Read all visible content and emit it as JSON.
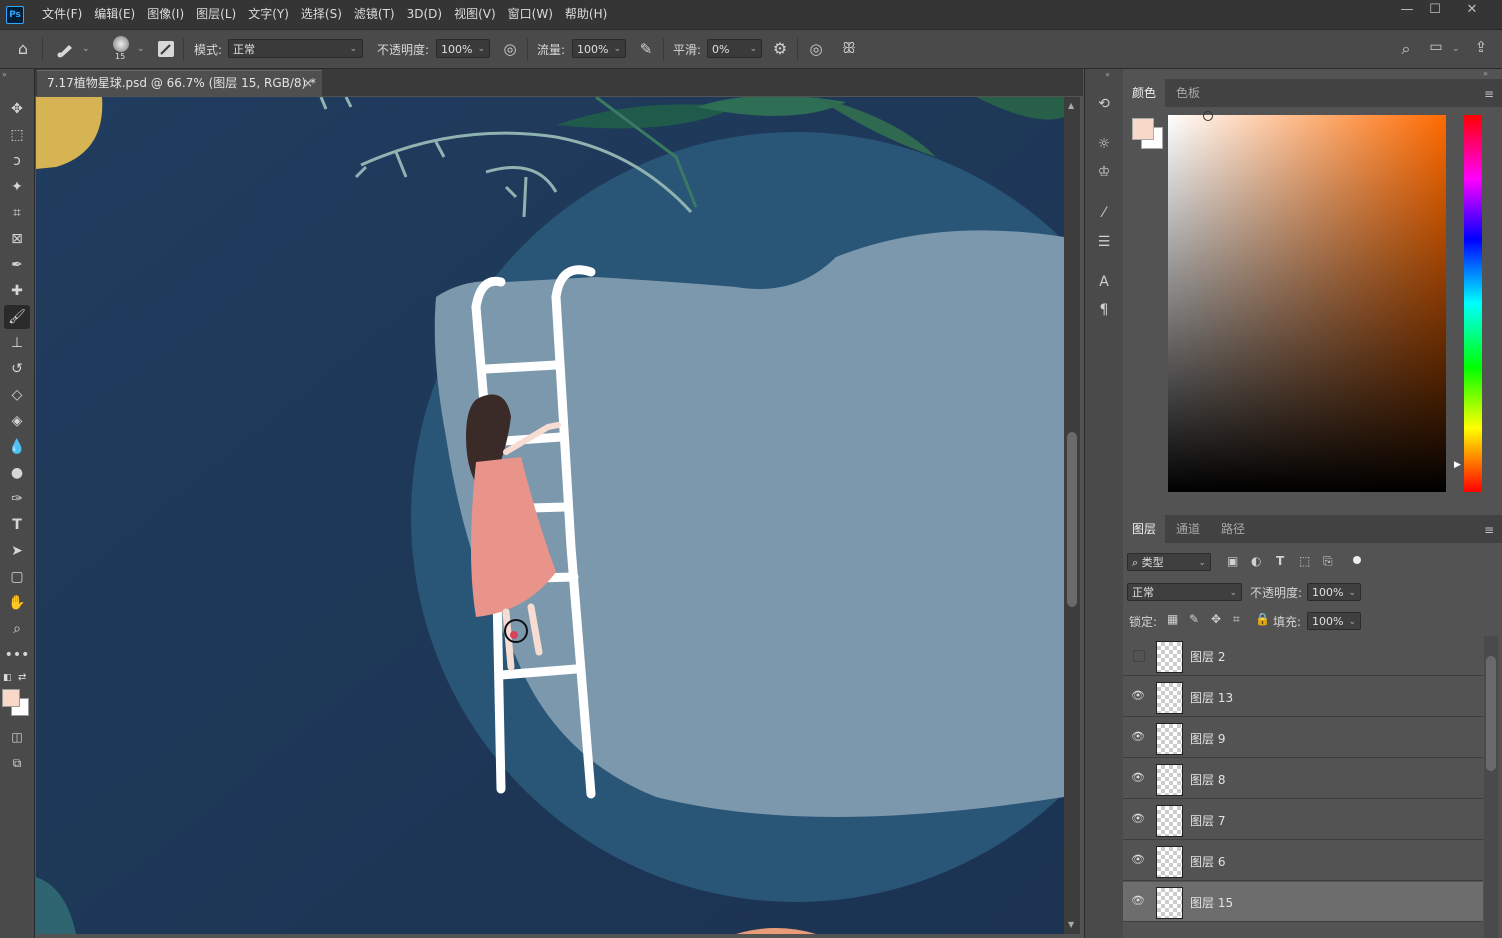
{
  "app": {
    "logo": "Ps"
  },
  "menu": [
    "文件(F)",
    "编辑(E)",
    "图像(I)",
    "图层(L)",
    "文字(Y)",
    "选择(S)",
    "滤镜(T)",
    "3D(D)",
    "视图(V)",
    "窗口(W)",
    "帮助(H)"
  ],
  "window_controls": {
    "minimize": "—",
    "maximize": "☐",
    "close": "✕"
  },
  "options": {
    "brush_size": "15",
    "mode_label": "模式:",
    "mode_value": "正常",
    "opacity_label": "不透明度:",
    "opacity_value": "100%",
    "flow_label": "流量:",
    "flow_value": "100%",
    "smoothing_label": "平滑:",
    "smoothing_value": "0%"
  },
  "document": {
    "tab_title": "7.17植物星球.psd @ 66.7% (图层 15, RGB/8) *",
    "close_glyph": "×"
  },
  "colors": {
    "foreground": "#f8d8c8",
    "background": "#ffffff",
    "canvas_bg": "#1f3a5a",
    "planet": "#7c98ad",
    "dress": "#e8948a"
  },
  "color_panel": {
    "tabs": [
      "颜色",
      "色板"
    ],
    "active_tab": "颜色"
  },
  "layers_panel": {
    "tabs": [
      "图层",
      "通道",
      "路径"
    ],
    "active_tab": "图层",
    "filter_label": "类型",
    "blend_mode": "正常",
    "opacity_label": "不透明度:",
    "opacity_value": "100%",
    "lock_label": "锁定:",
    "fill_label": "填充:",
    "fill_value": "100%",
    "layers": [
      {
        "name": "图层 2",
        "visible": false,
        "selected": false
      },
      {
        "name": "图层 13",
        "visible": true,
        "selected": false
      },
      {
        "name": "图层 9",
        "visible": true,
        "selected": false
      },
      {
        "name": "图层 8",
        "visible": true,
        "selected": false
      },
      {
        "name": "图层 7",
        "visible": true,
        "selected": false
      },
      {
        "name": "图层 6",
        "visible": true,
        "selected": false
      },
      {
        "name": "图层 15",
        "visible": true,
        "selected": true
      }
    ]
  }
}
